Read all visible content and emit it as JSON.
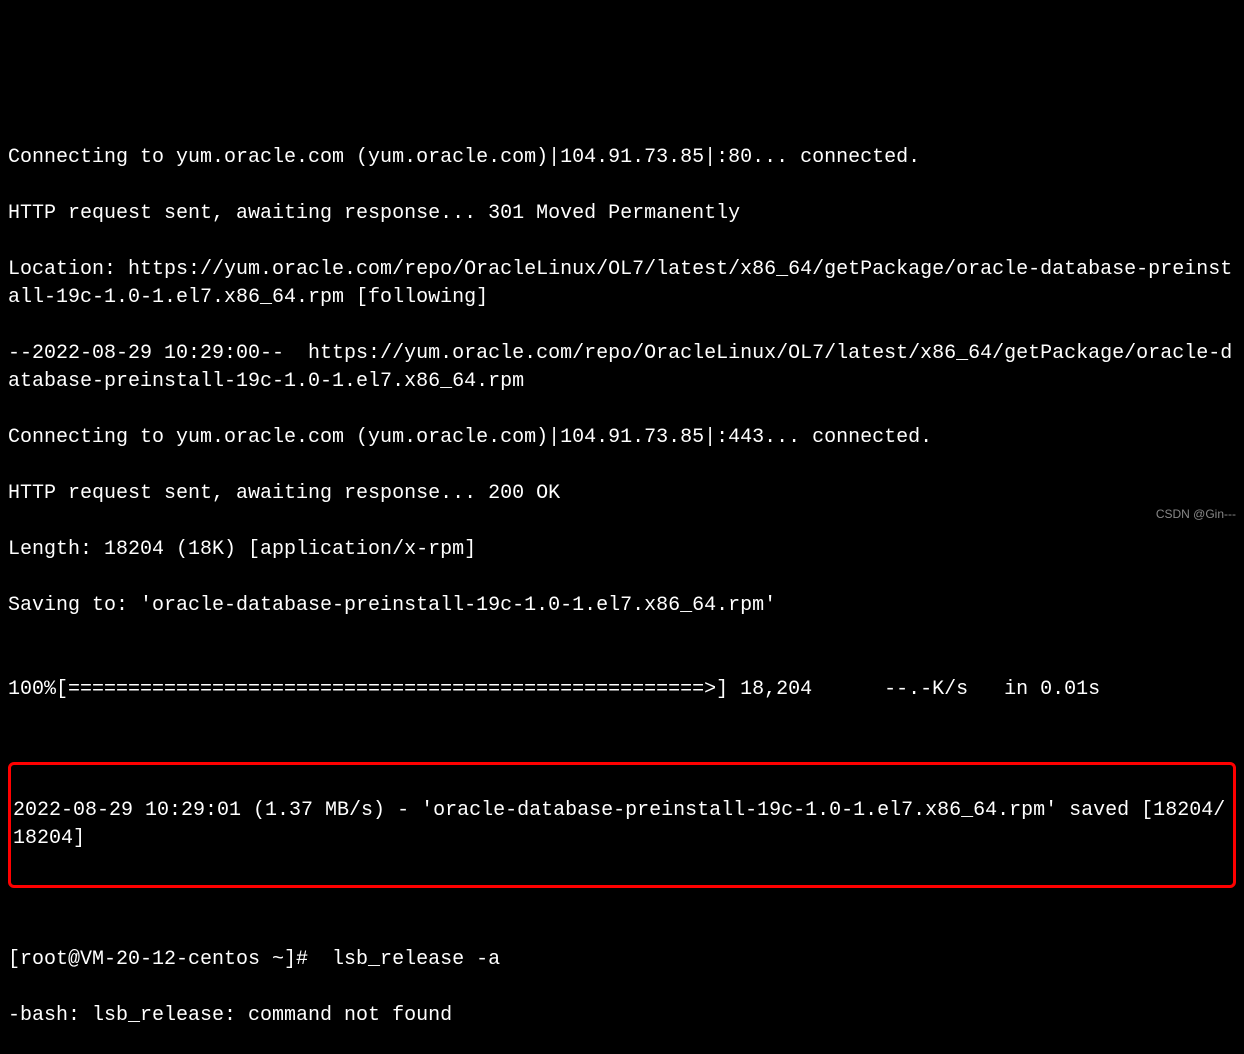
{
  "terminal": {
    "line1": "Connecting to yum.oracle.com (yum.oracle.com)|104.91.73.85|:80... connected.",
    "line2": "HTTP request sent, awaiting response... 301 Moved Permanently",
    "line3": "Location: https://yum.oracle.com/repo/OracleLinux/OL7/latest/x86_64/getPackage/oracle-database-preinstall-19c-1.0-1.el7.x86_64.rpm [following]",
    "line4": "--2022-08-29 10:29:00--  https://yum.oracle.com/repo/OracleLinux/OL7/latest/x86_64/getPackage/oracle-database-preinstall-19c-1.0-1.el7.x86_64.rpm",
    "line5": "Connecting to yum.oracle.com (yum.oracle.com)|104.91.73.85|:443... connected.",
    "line6": "HTTP request sent, awaiting response... 200 OK",
    "line7": "Length: 18204 (18K) [application/x-rpm]",
    "line8": "Saving to: 'oracle-database-preinstall-19c-1.0-1.el7.x86_64.rpm'",
    "blank1": "",
    "progress": "100%[=====================================================>] 18,204      --.-K/s   in 0.01s",
    "blank2": "",
    "saved": "2022-08-29 10:29:01 (1.37 MB/s) - 'oracle-database-preinstall-19c-1.0-1.el7.x86_64.rpm' saved [18204/18204]",
    "blank3": "",
    "prompt": "[root@VM-20-12-centos ~]#  lsb_release -a",
    "error": "-bash: lsb_release: command not found"
  },
  "watermark": "CSDN @Gin---"
}
